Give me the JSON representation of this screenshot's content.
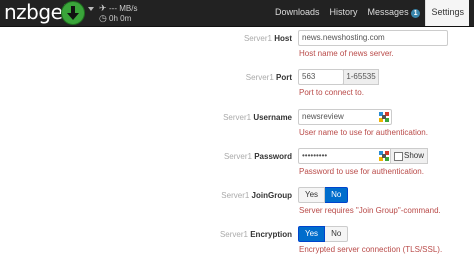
{
  "app": {
    "logo": "nzbget",
    "speed": "--- MB/s",
    "remaining": "0h 0m"
  },
  "nav": {
    "items": [
      {
        "label": "Downloads"
      },
      {
        "label": "History"
      },
      {
        "label": "Messages",
        "badge": "1"
      },
      {
        "label": "Settings"
      }
    ]
  },
  "form": {
    "host": {
      "prefix": "Server1",
      "label": "Host",
      "value": "news.newshosting.com",
      "help": "Host name of news server."
    },
    "port": {
      "prefix": "Server1",
      "label": "Port",
      "value": "563",
      "range": "1-65535",
      "help": "Port to connect to."
    },
    "username": {
      "prefix": "Server1",
      "label": "Username",
      "value": "newsreview",
      "help": "User name to use for authentication."
    },
    "password": {
      "prefix": "Server1",
      "label": "Password",
      "value": "•••••••••",
      "show_label": "Show",
      "help": "Password to use for authentication."
    },
    "joingroup": {
      "prefix": "Server1",
      "label": "JoinGroup",
      "yes": "Yes",
      "no": "No",
      "selected": "No",
      "help": "Server requires \"Join Group\"-command."
    },
    "encryption": {
      "prefix": "Server1",
      "label": "Encryption",
      "yes": "Yes",
      "no": "No",
      "selected": "Yes",
      "help": "Encrypted server connection (TLS/SSL)."
    }
  },
  "colors": {
    "accent": "#006dcc",
    "help_text": "#b94a48",
    "navbar": "#222222",
    "play": "#3aa53a"
  },
  "icons": {
    "play": "download-arrow-icon",
    "plane": "plane-icon",
    "clock": "clock-icon",
    "keepass": "keepass-icon"
  }
}
